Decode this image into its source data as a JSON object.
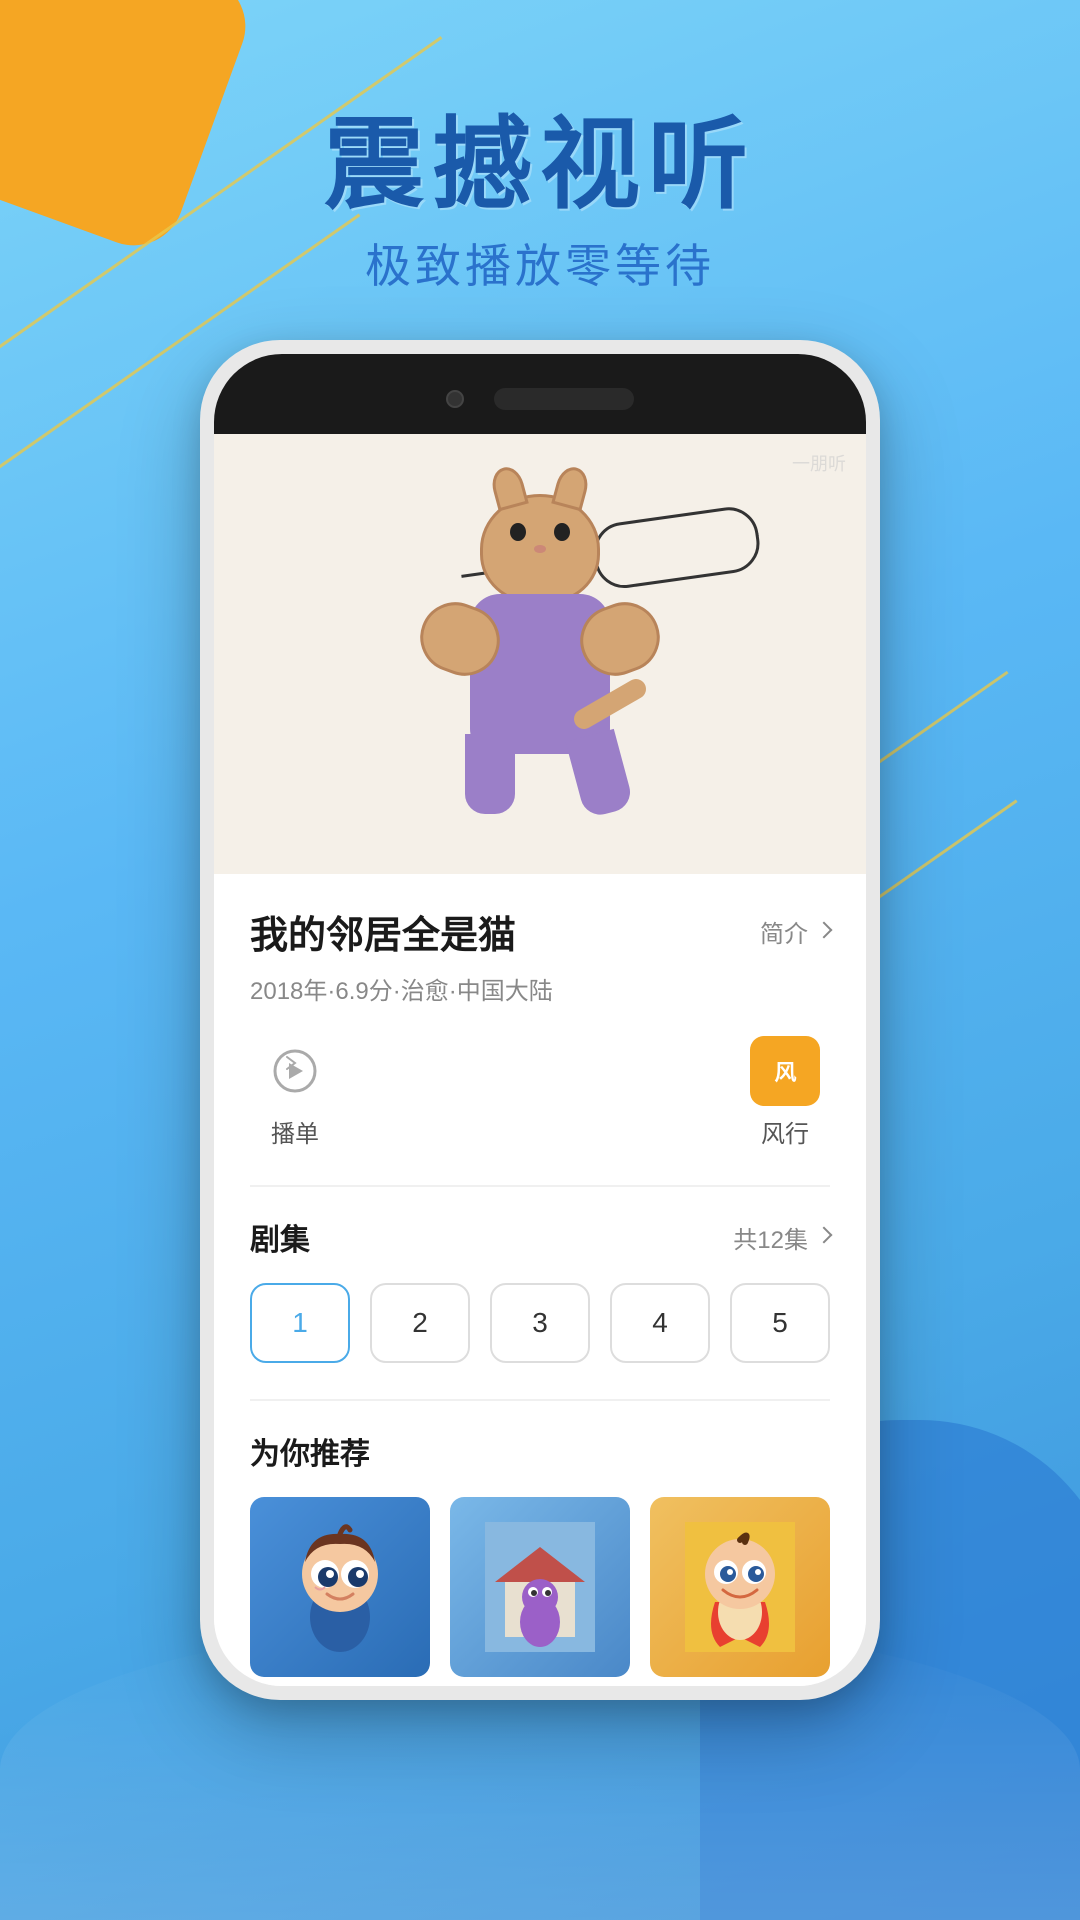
{
  "background": {
    "primary_color": "#5ab8f5",
    "secondary_color": "#4aaae8",
    "accent_color": "#f5a623",
    "dark_blue": "#2d7fd4"
  },
  "header": {
    "main_title": "震撼视听",
    "sub_title": "极致播放零等待"
  },
  "phone": {
    "watermark": "一朋听"
  },
  "show": {
    "title": "我的邻居全是猫",
    "intro_label": "简介",
    "meta": "2018年·6.9分·治愈·中国大陆",
    "playlist_label": "播单",
    "platform_label": "风行",
    "episodes_label": "剧集",
    "total_episodes": "共12集",
    "episodes": [
      1,
      2,
      3,
      4,
      5
    ],
    "active_episode": 1,
    "recommend_title": "为你推荐"
  },
  "recommend": {
    "cards": [
      {
        "id": 1,
        "color": "#3a7cc0"
      },
      {
        "id": 2,
        "color": "#6aaad0"
      },
      {
        "id": 3,
        "color": "#e8a030"
      }
    ]
  }
}
